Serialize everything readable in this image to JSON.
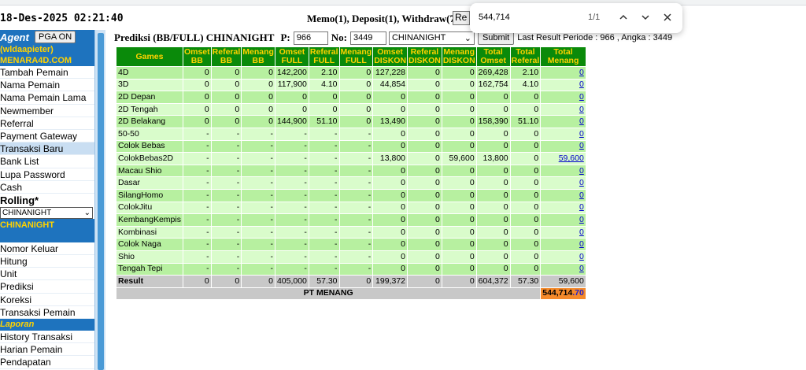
{
  "clock": "18-Des-2025 02:21:40",
  "memo": "Memo(1), Deposit(1), Withdraw(7)",
  "memo_button_label": "Re",
  "find": {
    "value": "544,714",
    "count": "1/1"
  },
  "sidebar": {
    "agent_title": "Agent",
    "pga_button": "PGA ON",
    "username": "(wldaapieter)",
    "site": "MENARA4D.COM",
    "items_top": [
      "Tambah Pemain",
      "Nama Pemain",
      "Nama Pemain Lama",
      "Newmember",
      "Referral",
      "Payment Gateway",
      "Transaksi Baru",
      "Bank List",
      "Lupa Password",
      "Cash"
    ],
    "active_item": "Transaksi Baru",
    "rolling_label": "Rolling*",
    "rolling_select": "CHINANIGHT",
    "market_banner": "CHINANIGHT",
    "items_mid": [
      "Nomor Keluar",
      "Hitung",
      "Unit",
      "Prediksi",
      "Koreksi",
      "Transaksi Pemain"
    ],
    "laporan_label": "Laporan",
    "items_bottom": [
      "History Transaksi",
      "Harian Pemain",
      "Pendapatan"
    ]
  },
  "form": {
    "title": "Prediksi (BB/FULL) CHINANIGHT",
    "p_label": "P:",
    "p_value": "966",
    "no_label": "No:",
    "no_value": "3449",
    "market_select": "CHINANIGHT",
    "submit_label": "Submit",
    "last_result": "Last Result Periode : 966 , Angka : 3449"
  },
  "table": {
    "headers": [
      "Games",
      "Omset BB",
      "Referal BB",
      "Menang BB",
      "Omset FULL",
      "Referal FULL",
      "Menang FULL",
      "Omset DISKON",
      "Referal DISKON",
      "Menang DISKON",
      "Total Omset",
      "Total Referal",
      "Total Menang"
    ],
    "rows": [
      [
        "4D",
        "0",
        "0",
        "0",
        "142,200",
        "2.10",
        "0",
        "127,228",
        "0",
        "0",
        "269,428",
        "2.10",
        "0"
      ],
      [
        "3D",
        "0",
        "0",
        "0",
        "117,900",
        "4.10",
        "0",
        "44,854",
        "0",
        "0",
        "162,754",
        "4.10",
        "0"
      ],
      [
        "2D Depan",
        "0",
        "0",
        "0",
        "0",
        "0",
        "0",
        "0",
        "0",
        "0",
        "0",
        "0",
        "0"
      ],
      [
        "2D Tengah",
        "0",
        "0",
        "0",
        "0",
        "0",
        "0",
        "0",
        "0",
        "0",
        "0",
        "0",
        "0"
      ],
      [
        "2D Belakang",
        "0",
        "0",
        "0",
        "144,900",
        "51.10",
        "0",
        "13,490",
        "0",
        "0",
        "158,390",
        "51.10",
        "0"
      ],
      [
        "50-50",
        "-",
        "-",
        "-",
        "-",
        "-",
        "-",
        "0",
        "0",
        "0",
        "0",
        "0",
        "0"
      ],
      [
        "Colok Bebas",
        "-",
        "-",
        "-",
        "-",
        "-",
        "-",
        "0",
        "0",
        "0",
        "0",
        "0",
        "0"
      ],
      [
        "ColokBebas2D",
        "-",
        "-",
        "-",
        "-",
        "-",
        "-",
        "13,800",
        "0",
        "59,600",
        "13,800",
        "0",
        "59,600"
      ],
      [
        "Macau Shio",
        "-",
        "-",
        "-",
        "-",
        "-",
        "-",
        "0",
        "0",
        "0",
        "0",
        "0",
        "0"
      ],
      [
        "Dasar",
        "-",
        "-",
        "-",
        "-",
        "-",
        "-",
        "0",
        "0",
        "0",
        "0",
        "0",
        "0"
      ],
      [
        "SilangHomo",
        "-",
        "-",
        "-",
        "-",
        "-",
        "-",
        "0",
        "0",
        "0",
        "0",
        "0",
        "0"
      ],
      [
        "ColokJitu",
        "-",
        "-",
        "-",
        "-",
        "-",
        "-",
        "0",
        "0",
        "0",
        "0",
        "0",
        "0"
      ],
      [
        "KembangKempis",
        "-",
        "-",
        "-",
        "-",
        "-",
        "-",
        "0",
        "0",
        "0",
        "0",
        "0",
        "0"
      ],
      [
        "Kombinasi",
        "-",
        "-",
        "-",
        "-",
        "-",
        "-",
        "0",
        "0",
        "0",
        "0",
        "0",
        "0"
      ],
      [
        "Colok Naga",
        "-",
        "-",
        "-",
        "-",
        "-",
        "-",
        "0",
        "0",
        "0",
        "0",
        "0",
        "0"
      ],
      [
        "Shio",
        "-",
        "-",
        "-",
        "-",
        "-",
        "-",
        "0",
        "0",
        "0",
        "0",
        "0",
        "0"
      ],
      [
        "Tengah Tepi",
        "-",
        "-",
        "-",
        "-",
        "-",
        "-",
        "0",
        "0",
        "0",
        "0",
        "0",
        "0"
      ]
    ],
    "result": [
      "Result",
      "0",
      "0",
      "0",
      "405,000",
      "57.30",
      "0",
      "199,372",
      "0",
      "0",
      "604,372",
      "57.30",
      "59,600"
    ],
    "pt_label": "PT MENANG",
    "pt_value": "544,714",
    "pt_decimal": ".70"
  },
  "colors": {
    "header_green": "#0a8a0a",
    "header_text": "#ffd200",
    "row_light": "#d9fccb",
    "row_dark": "#b7f0a0",
    "sidebar_blue": "#1e73be",
    "pt_orange": "#f58a2a"
  }
}
